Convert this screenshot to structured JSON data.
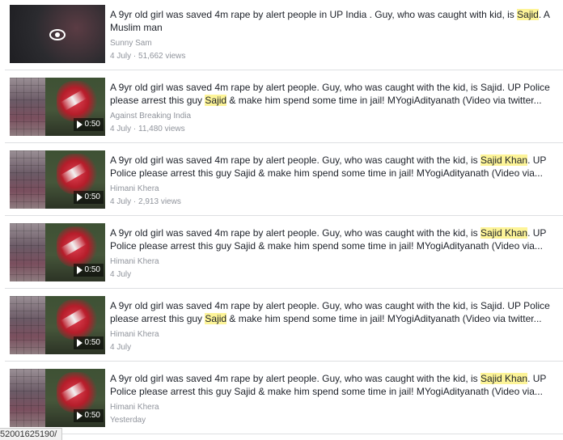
{
  "results": [
    {
      "title_parts": [
        "A 9yr old girl was saved 4m rape by alert people in UP India . Guy, who was caught with kid, is ",
        "Sajid",
        ". A Muslim man"
      ],
      "author": "Sunny Sam",
      "meta": "4 July · 51,662 views",
      "duration": "",
      "thumb_icon": "eye-icon"
    },
    {
      "title_parts": [
        "A 9yr old girl was saved 4m rape by alert people. Guy, who was caught with the kid, is Sajid. UP Police please arrest this guy ",
        "Sajid",
        " & make him spend some time in jail! MYogiAdityanath (Video via twitter..."
      ],
      "author": "Against Breaking India",
      "meta": "4 July · 11,480 views",
      "duration": "0:50",
      "thumb_icon": "play-icon"
    },
    {
      "title_parts": [
        "A 9yr old girl was saved 4m rape by alert people. Guy, who was caught with the kid, is ",
        "Sajid Khan",
        ". UP Police please arrest this guy Sajid & make him spend some time in jail! MYogiAdityanath (Video via..."
      ],
      "author": "Himani Khera",
      "meta": "4 July · 2,913 views",
      "duration": "0:50",
      "thumb_icon": "play-icon"
    },
    {
      "title_parts": [
        "A 9yr old girl was saved 4m rape by alert people. Guy, who was caught with the kid, is ",
        "Sajid Khan",
        ". UP Police please arrest this guy Sajid & make him spend some time in jail! MYogiAdityanath (Video via..."
      ],
      "author": "Himani Khera",
      "meta": "4 July",
      "duration": "0:50",
      "thumb_icon": "play-icon"
    },
    {
      "title_parts": [
        "A 9yr old girl was saved 4m rape by alert people. Guy, who was caught with the kid, is Sajid. UP Police please arrest this guy ",
        "Sajid",
        " & make him spend some time in jail! MYogiAdityanath (Video via twitter..."
      ],
      "author": "Himani Khera",
      "meta": "4 July",
      "duration": "0:50",
      "thumb_icon": "play-icon"
    },
    {
      "title_parts": [
        "A 9yr old girl was saved 4m rape by alert people. Guy, who was caught with the kid, is ",
        "Sajid Khan",
        ". UP Police please arrest this guy Sajid & make him spend some time in jail! MYogiAdityanath (Video via..."
      ],
      "author": "Himani Khera",
      "meta": "Yesterday",
      "duration": "0:50",
      "thumb_icon": "play-icon"
    }
  ],
  "status_bar": {
    "url": "52001625190/"
  },
  "colors": {
    "highlight": "#fdf498",
    "title_text": "#1d2129",
    "meta_text": "#90949c"
  }
}
